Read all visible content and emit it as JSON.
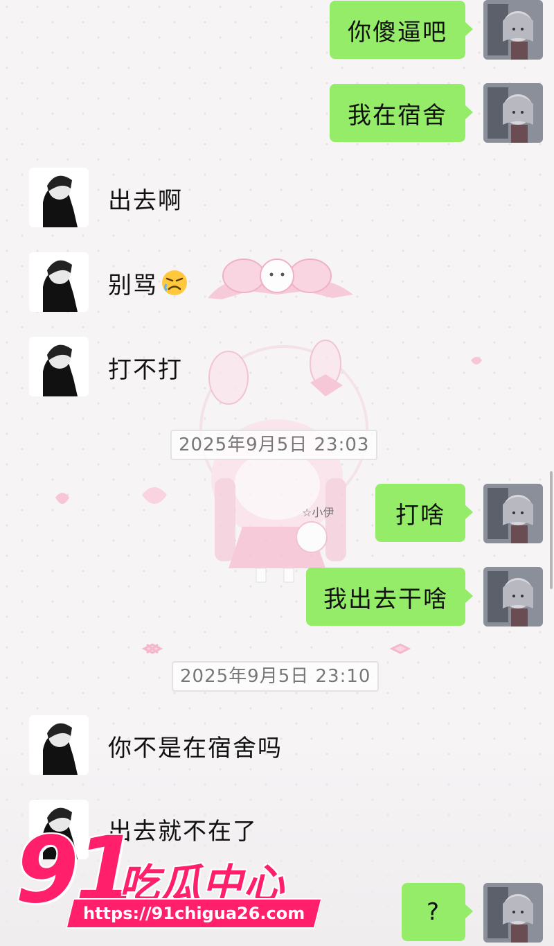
{
  "messages": [
    {
      "side": "me",
      "text": "你傻逼吧"
    },
    {
      "side": "me",
      "text": "我在宿舍"
    },
    {
      "side": "peer",
      "text": "出去啊"
    },
    {
      "side": "peer",
      "text": "别骂",
      "emoji": "angry-face-emoji"
    },
    {
      "side": "peer",
      "text": "打不打"
    },
    {
      "side": "me",
      "text": "打啥"
    },
    {
      "side": "me",
      "text": "我出去干啥"
    },
    {
      "side": "peer",
      "text": "你不是在宿舍吗"
    },
    {
      "side": "peer",
      "text": "出去就不在了"
    },
    {
      "side": "me",
      "text": "?"
    }
  ],
  "timestamps": [
    "2025年9月5日 23:03",
    "2025年9月5日 23:10"
  ],
  "wallpaper": {
    "caption": "☆小伊"
  },
  "watermark": {
    "number": "91",
    "title": "吃瓜中心",
    "url": "https://91chigua26.com"
  },
  "colors": {
    "my_bubble": "#95ec69",
    "watermark": "#ff1f6b",
    "wallpaper_pink": "#f7c6d6"
  }
}
